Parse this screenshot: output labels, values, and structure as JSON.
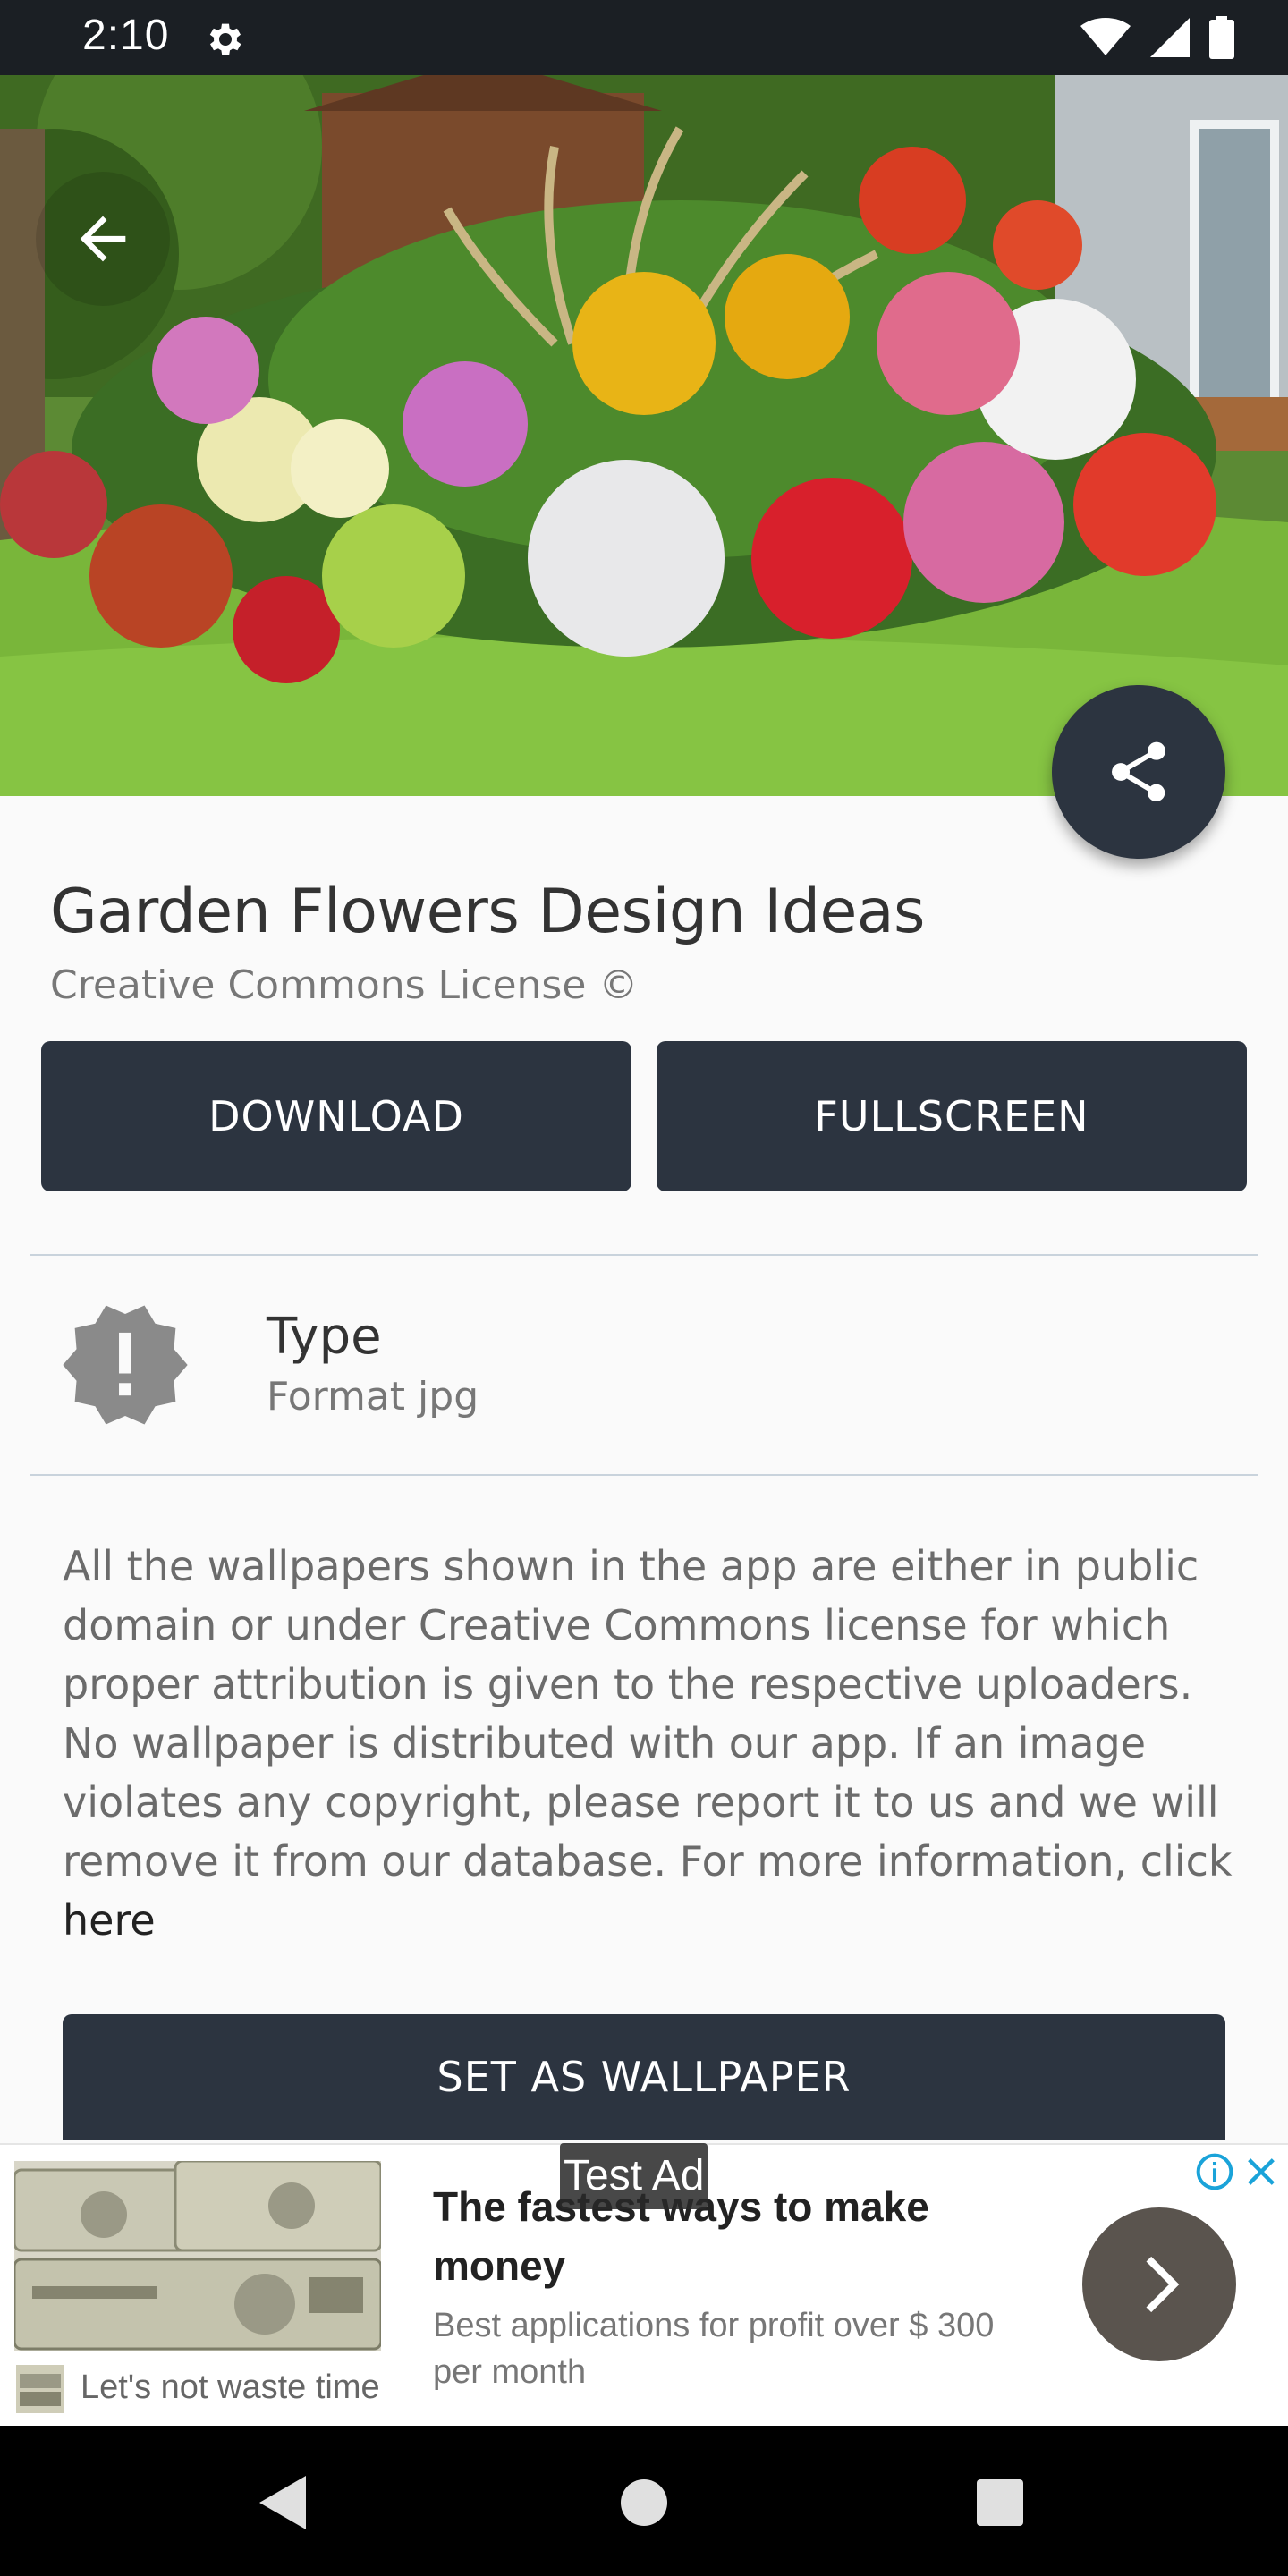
{
  "status_bar": {
    "time": "2:10"
  },
  "title": "Garden Flowers Design Ideas",
  "subtitle": "Creative Commons License ©",
  "buttons": {
    "download": "DOWNLOAD",
    "fullscreen": "FULLSCREEN",
    "set_wallpaper": "SET AS WALLPAPER"
  },
  "type_info": {
    "label": "Type",
    "value": "Format jpg"
  },
  "info": {
    "text": "All the wallpapers shown in the app are either in public domain or under Creative Commons license for which proper attribution is given to the respective uploaders. No wallpaper is distributed with our app. If an image violates any copyright, please report it to us and we will remove it from our database. For more information, click ",
    "link": "here"
  },
  "ad": {
    "badge": "Test Ad",
    "headline": "The fastest ways to make money",
    "body": "Best applications for profit over $ 300 per month",
    "sponsor": "Let's not waste time"
  },
  "colors": {
    "primary_dark": "#2c3440",
    "status_bar": "#1b1f24",
    "nav_bar": "#000000"
  },
  "icons": [
    "gear-icon",
    "wifi-icon",
    "signal-icon",
    "battery-icon",
    "back-arrow-icon",
    "share-icon",
    "alert-badge-icon",
    "ad-info-icon",
    "close-icon",
    "chevron-right-icon",
    "nav-back-icon",
    "nav-home-icon",
    "nav-recents-icon"
  ]
}
